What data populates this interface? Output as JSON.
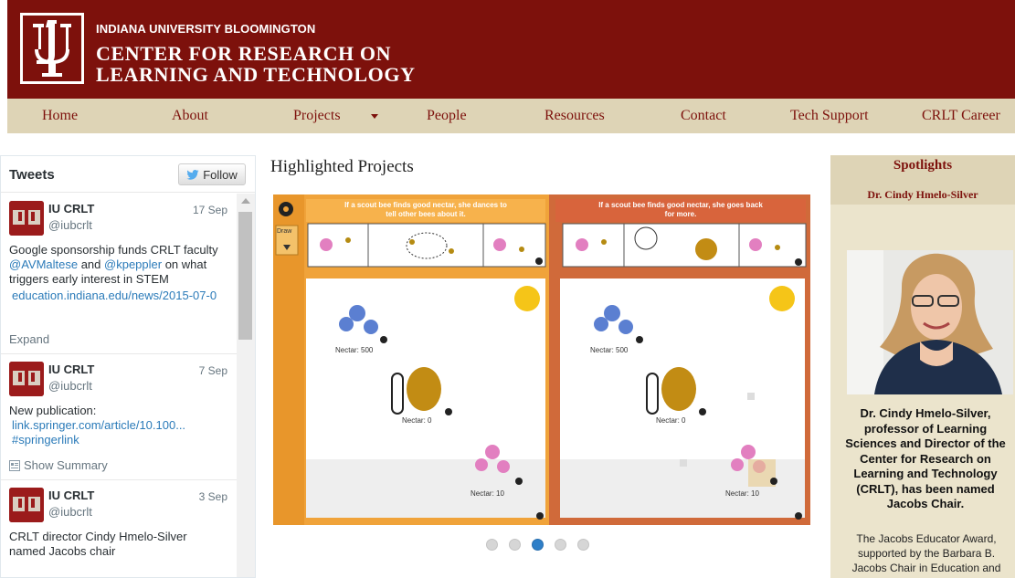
{
  "header": {
    "university": "INDIANA UNIVERSITY BLOOMINGTON",
    "title_line1": "CENTER FOR RESEARCH ON",
    "title_line2": "LEARNING AND TECHNOLOGY",
    "logo_icon": "iu-trident-logo",
    "brand_color": "#7d110c"
  },
  "nav": {
    "items": [
      "Home",
      "About",
      "Projects",
      "People",
      "Resources",
      "Contact",
      "Tech Support",
      "CRLT Career"
    ],
    "dropdown_icon": "caret-down-icon",
    "background": "#ded4b6"
  },
  "tweets": {
    "title": "Tweets",
    "follow_label": "Follow",
    "items": [
      {
        "name": "IU CRLT",
        "handle": "@iubcrlt",
        "date": "17 Sep",
        "text_pre": "Google sponsorship funds CRLT faculty ",
        "mention1": "@AVMaltese",
        "text_mid": " and ",
        "mention2": "@kpeppler",
        "text_post": " on what triggers early interest in STEM",
        "link": "education.indiana.edu/news/2015-07-0",
        "footer": "Expand"
      },
      {
        "name": "IU CRLT",
        "handle": "@iubcrlt",
        "date": "7 Sep",
        "text": "New publication:",
        "link": "link.springer.com/article/10.100...",
        "hashtag": "#springerlink",
        "footer": "Show Summary"
      },
      {
        "name": "IU CRLT",
        "handle": "@iubcrlt",
        "date": "3 Sep",
        "text": "CRLT director Cindy Hmelo-Silver named Jacobs chair"
      }
    ]
  },
  "highlighted": {
    "title": "Highlighted Projects",
    "slide": {
      "left_caption_1": "If a scout bee finds good nectar, she dances to",
      "left_caption_2": "tell other bees about it.",
      "right_caption_1": "If a scout bee finds good nectar, she goes back",
      "right_caption_2": "for more.",
      "draw_label": "Draw",
      "nectar_500": "Nectar: 500",
      "nectar_0": "Nectar: 0",
      "nectar_10": "Nectar: 10"
    },
    "carousel": {
      "count": 5,
      "active_index": 2
    }
  },
  "spotlights": {
    "title": "Spotlights",
    "person": "Dr. Cindy Hmelo-Silver",
    "bio_bold": "Dr. Cindy Hmelo-Silver, professor of Learning Sciences and Director of the Center for Research on Learning and Technology (CRLT), has been named Jacobs Chair.",
    "bio": "The Jacobs Educator Award, supported by the Barbara B. Jacobs Chair in Education and"
  }
}
